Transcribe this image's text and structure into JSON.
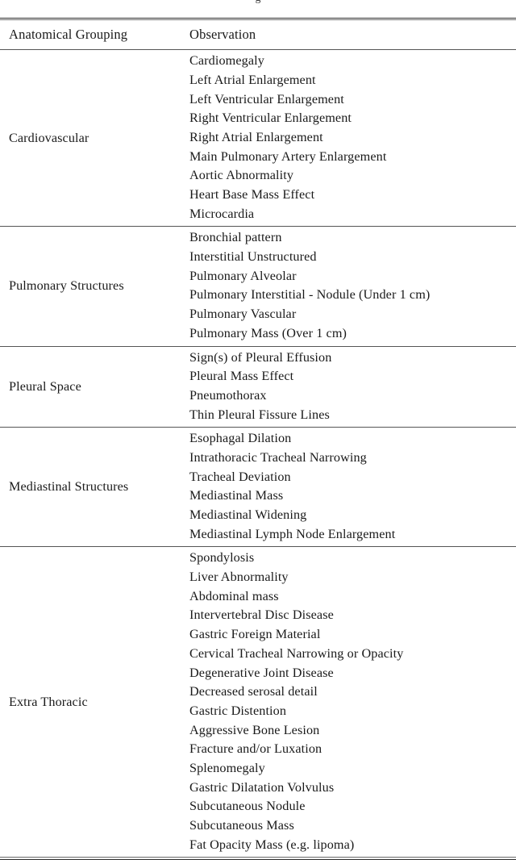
{
  "document": {
    "type": "academic-table",
    "clipped_caption_fragment": "g",
    "columns": [
      "Anatomical Grouping",
      "Observation"
    ],
    "sections": [
      {
        "group": "Cardiovascular",
        "observations": [
          "Cardiomegaly",
          "Left Atrial Enlargement",
          "Left Ventricular Enlargement",
          "Right Ventricular Enlargement",
          "Right Atrial Enlargement",
          "Main Pulmonary Artery Enlargement",
          "Aortic Abnormality",
          "Heart Base Mass Effect",
          "Microcardia"
        ]
      },
      {
        "group": "Pulmonary Structures",
        "observations": [
          "Bronchial pattern",
          "Interstitial Unstructured",
          "Pulmonary Alveolar",
          "Pulmonary Interstitial - Nodule (Under 1 cm)",
          "Pulmonary Vascular",
          "Pulmonary Mass (Over 1 cm)"
        ]
      },
      {
        "group": "Pleural Space",
        "observations": [
          "Sign(s) of Pleural Effusion",
          "Pleural Mass Effect",
          "Pneumothorax",
          "Thin Pleural Fissure Lines"
        ]
      },
      {
        "group": "Mediastinal Structures",
        "observations": [
          "Esophagal Dilation",
          "Intrathoracic Tracheal Narrowing",
          "Tracheal Deviation",
          "Mediastinal Mass",
          "Mediastinal Widening",
          "Mediastinal Lymph Node Enlargement"
        ]
      },
      {
        "group": "Extra Thoracic",
        "observations": [
          "Spondylosis",
          "Liver Abnormality",
          "Abdominal mass",
          "Intervertebral Disc Disease",
          "Gastric Foreign Material",
          "Cervical Tracheal Narrowing or Opacity",
          "Degenerative Joint Disease",
          "Decreased serosal detail",
          "Gastric Distention",
          "Aggressive Bone Lesion",
          "Fracture and/or Luxation",
          "Splenomegaly",
          "Gastric Dilatation Volvulus",
          "Subcutaneous Nodule",
          "Subcutaneous Mass",
          "Fat Opacity Mass (e.g. lipoma)"
        ]
      }
    ]
  },
  "style": {
    "text_color": "#1a1a1a",
    "rule_color_heavy": "#2b2b2b",
    "rule_color_light": "#6a6a6a",
    "background": "#ffffff"
  }
}
